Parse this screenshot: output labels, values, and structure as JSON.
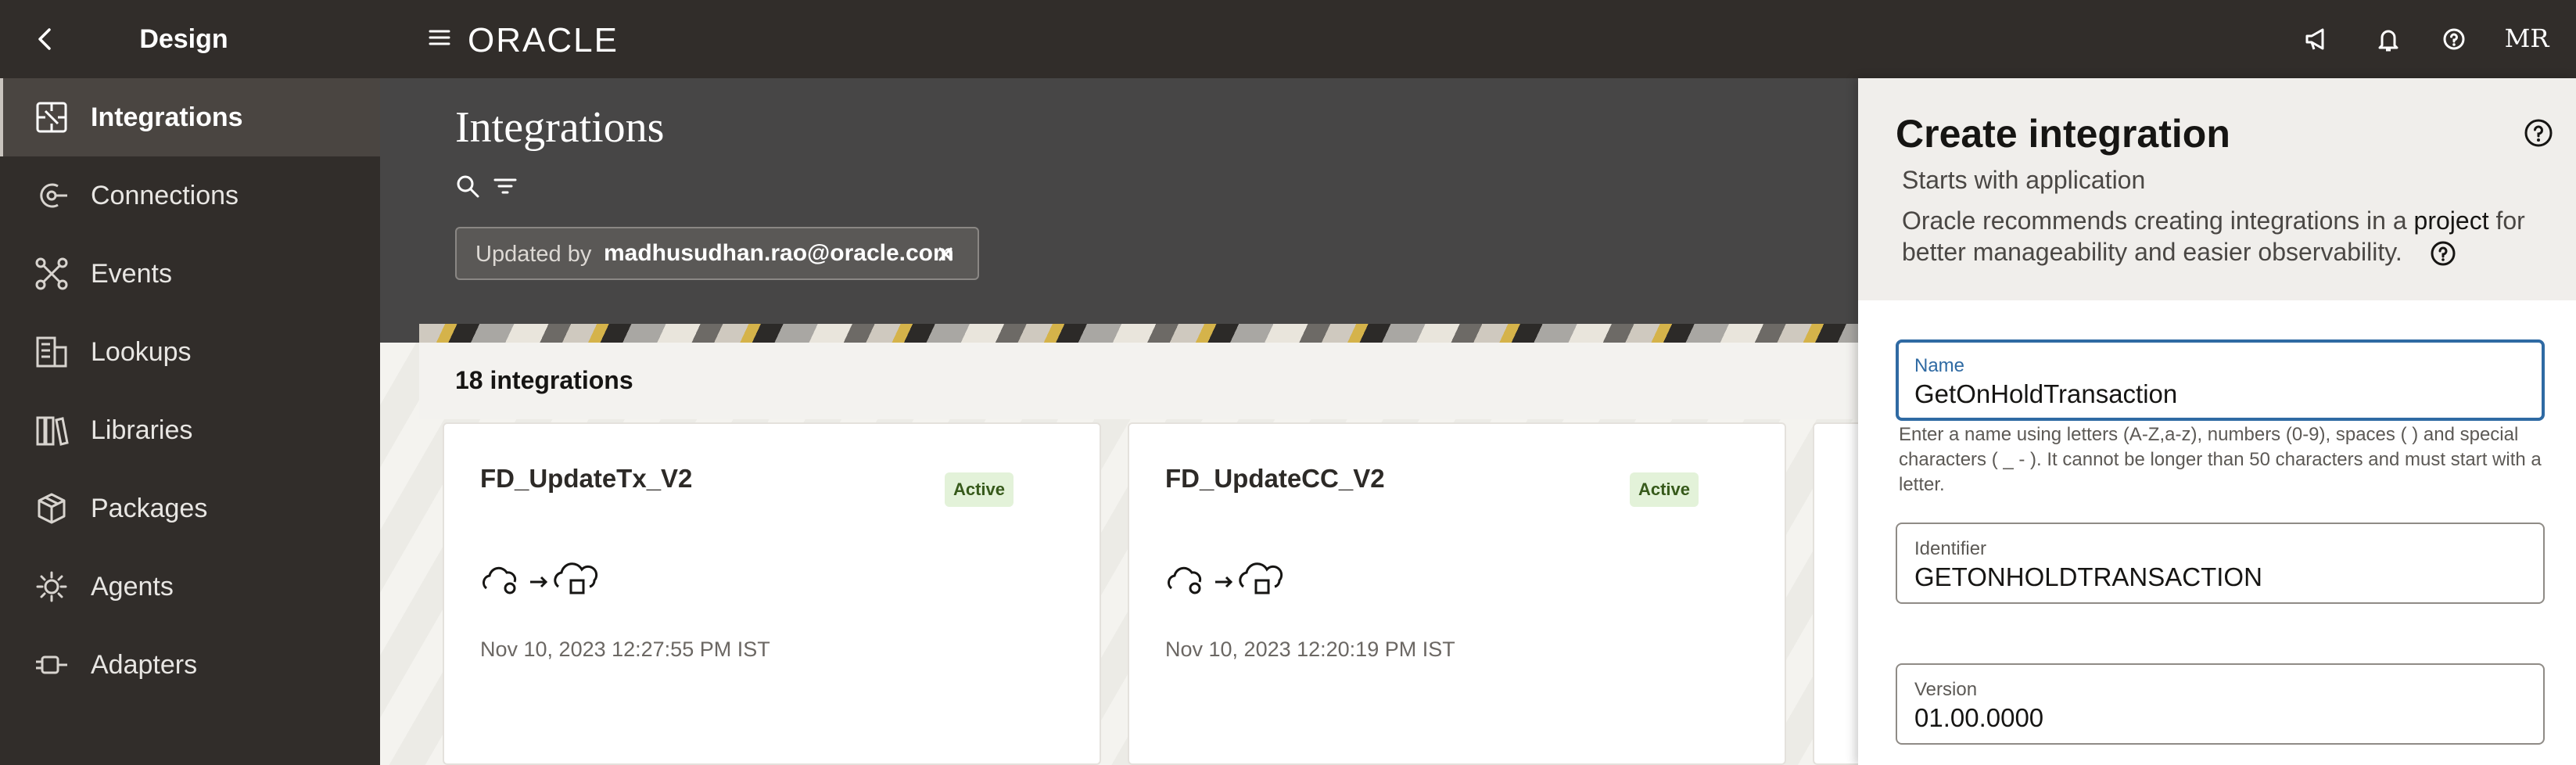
{
  "topbar": {
    "section_title": "Design",
    "avatar_initials": "MR",
    "icons": [
      "back-chevron-icon",
      "hamburger-menu-icon",
      "announcement-icon",
      "bell-icon",
      "help-icon"
    ]
  },
  "sidebar": {
    "items": [
      {
        "label": "Integrations",
        "icon": "integrations-icon",
        "active": true
      },
      {
        "label": "Connections",
        "icon": "connections-icon"
      },
      {
        "label": "Events",
        "icon": "events-icon"
      },
      {
        "label": "Lookups",
        "icon": "lookups-icon"
      },
      {
        "label": "Libraries",
        "icon": "libraries-icon"
      },
      {
        "label": "Packages",
        "icon": "packages-icon"
      },
      {
        "label": "Agents",
        "icon": "agents-icon"
      },
      {
        "label": "Adapters",
        "icon": "adapters-icon"
      }
    ]
  },
  "main": {
    "page_title": "Integrations",
    "filter_chip": {
      "label": "Updated by",
      "value": "madhusudhan.rao@oracle.com"
    },
    "count_text": "18 integrations",
    "cards": [
      {
        "title": "FD_UpdateTx_V2",
        "status": "Active",
        "date": "Nov 10, 2023 12:27:55 PM IST"
      },
      {
        "title": "FD_UpdateCC_V2",
        "status": "Active",
        "date": "Nov 10, 2023 12:20:19 PM IST"
      }
    ]
  },
  "panel": {
    "title": "Create integration",
    "subtitle": "Starts with application",
    "rec_before": "Oracle recommends creating integrations in a ",
    "rec_link": "project",
    "rec_after": " for better manageability and easier observability.",
    "fields": {
      "name": {
        "label": "Name",
        "value": "GetOnHoldTransaction"
      },
      "identifier": {
        "label": "Identifier",
        "value": "GETONHOLDTRANSACTION"
      },
      "version": {
        "label": "Version",
        "value": "01.00.0000"
      }
    },
    "name_hint": "Enter a name using letters (A-Z,a-z), numbers (0-9), spaces ( ) and special characters ( _ - ). It cannot be longer than 50 characters and must start with a letter."
  },
  "colors": {
    "topbar_bg": "#312d2a",
    "header_bg": "#474646",
    "active_badge_bg": "#e3f2d9",
    "focus_border": "#2f6aa3"
  }
}
